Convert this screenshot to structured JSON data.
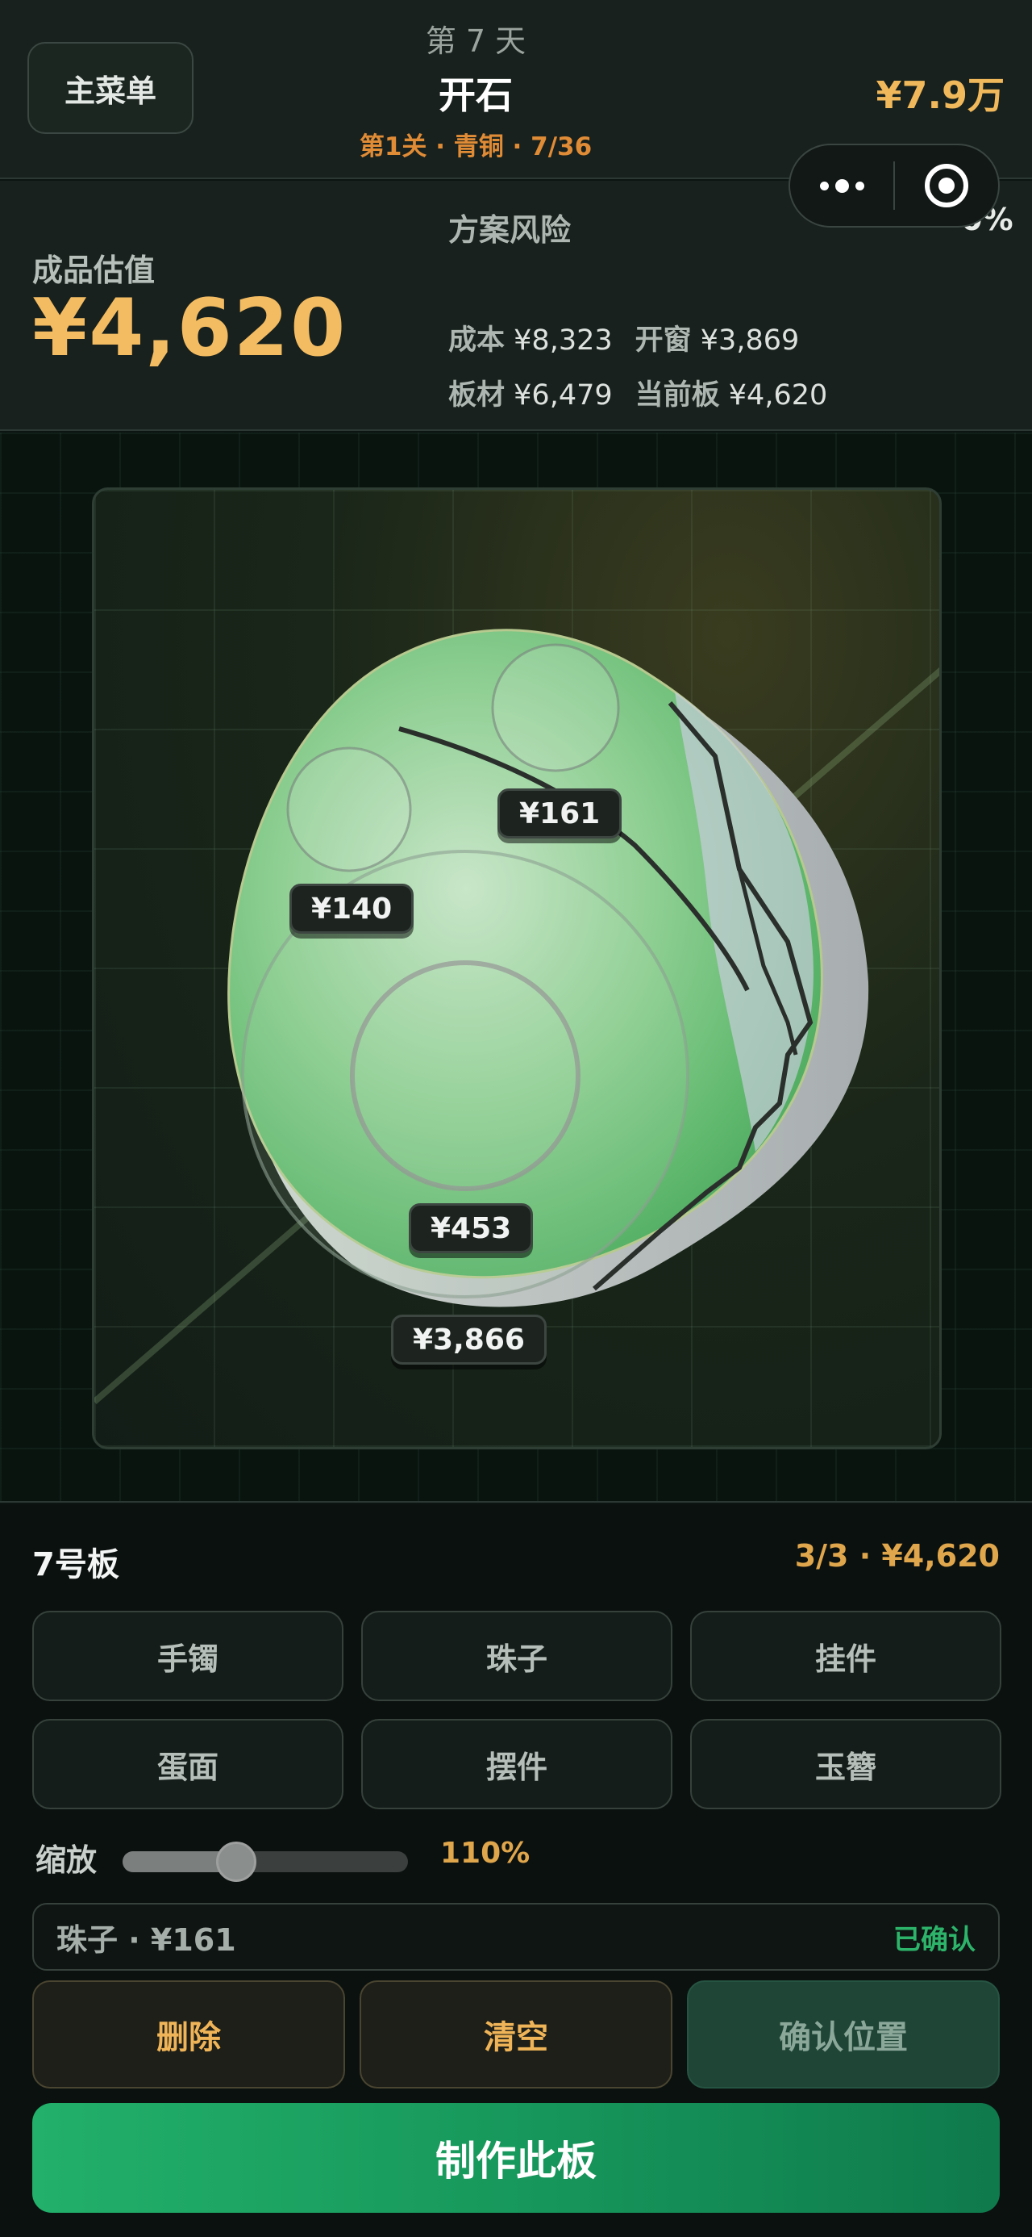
{
  "header": {
    "menu_label": "主菜单",
    "day": "第 7 天",
    "title": "开石",
    "level": "第1关 · 青铜 · 7/36",
    "money": "¥7.9万"
  },
  "estimate": {
    "label": "成品估值",
    "value": "¥4,620",
    "risk_label": "方案风险",
    "risk_value": "0%",
    "stats": {
      "cost_label": "成本",
      "cost_value": "¥8,323",
      "window_label": "开窗",
      "window_value": "¥3,869",
      "slab_label": "板材",
      "slab_value": "¥6,479",
      "current_label": "当前板",
      "current_value": "¥4,620"
    }
  },
  "stage": {
    "tags": [
      "¥161",
      "¥140",
      "¥453",
      "¥3,866"
    ]
  },
  "panel": {
    "board_name": "7号板",
    "progress": "3/3 · ¥4,620",
    "pieces": [
      "手镯",
      "珠子",
      "挂件",
      "蛋面",
      "摆件",
      "玉簪"
    ],
    "zoom_label": "缩放",
    "zoom_value": "110%",
    "zoom_level": 0.38,
    "selection_text": "珠子 · ¥161",
    "selection_status": "已确认",
    "delete_label": "删除",
    "clear_label": "清空",
    "confirm_label": "确认位置",
    "make_label": "制作此板"
  },
  "colors": {
    "accent_gold": "#f4bc62",
    "accent_orange": "#e08b36",
    "accent_green": "#22b06a",
    "confirmed_green": "#2db46a"
  }
}
